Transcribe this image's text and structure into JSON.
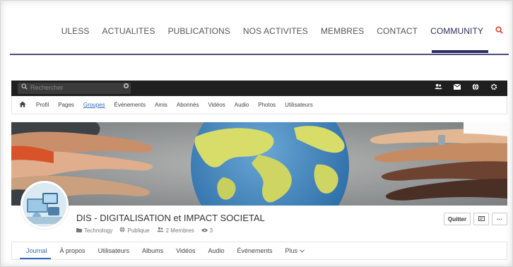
{
  "site_nav": {
    "items": [
      "ULESS",
      "ACTUALITES",
      "PUBLICATIONS",
      "NOS ACTIVITES",
      "MEMBRES",
      "CONTACT",
      "COMMUNITY"
    ],
    "active": "COMMUNITY",
    "search_icon": "search-icon"
  },
  "toolbar": {
    "search_placeholder": "Rechercher",
    "icons": [
      "users-icon",
      "envelope-icon",
      "globe-icon",
      "gear-icon"
    ]
  },
  "profile_nav": {
    "home_icon": "home-icon",
    "items": [
      "Profil",
      "Pages",
      "Groupes",
      "Événements",
      "Amis",
      "Abonnés",
      "Vidéos",
      "Audio",
      "Photos",
      "Utilisateurs"
    ],
    "active": "Groupes"
  },
  "group": {
    "title": "DIS - DIGITALISATION et IMPACT SOCIETAL",
    "category": "Technology",
    "privacy": "Publique",
    "members": "2 Membres",
    "views": "3"
  },
  "actions": {
    "quit_label": "Quitter",
    "message_icon": "message-icon",
    "more_label": "···"
  },
  "tabs": {
    "items": [
      "Journal",
      "À propos",
      "Utilisateurs",
      "Albums",
      "Vidéos",
      "Audio",
      "Événements",
      "Plus"
    ],
    "active": "Journal"
  },
  "colors": {
    "nav_accent": "#2d2f62",
    "search_accent": "#d9442c",
    "link_active": "#2f6bbf",
    "toolbar_bg": "#1f1f1f"
  }
}
